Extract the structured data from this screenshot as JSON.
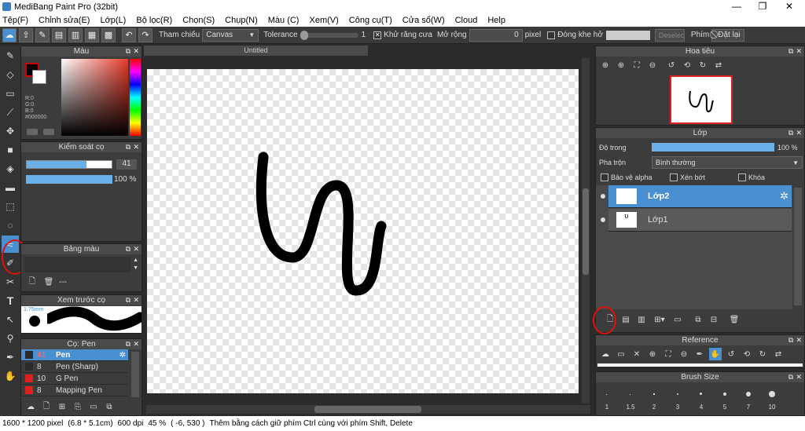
{
  "window": {
    "title": "MediBang Paint Pro (32bit)",
    "minimize": "—",
    "maximize": "❐",
    "close": "✕"
  },
  "menu": [
    "Tệp(F)",
    "Chỉnh sửa(E)",
    "Lớp(L)",
    "Bộ lọc(R)",
    "Chọn(S)",
    "Chụp(N)",
    "Màu (C)",
    "Xem(V)",
    "Công cụ(T)",
    "Cửa sổ(W)",
    "Cloud",
    "Help"
  ],
  "toolbar": {
    "reference_label": "Tham chiếu",
    "reference_value": "Canvas",
    "tolerance_label": "Tolerance",
    "tolerance_value": "1",
    "antialias_label": "Khử răng cưa",
    "expand_label": "Mở rộng",
    "expand_value": "0",
    "expand_unit": "pixel",
    "close_gap_label": "Đóng khe hở",
    "deselect_label": "Deselec",
    "key_label": "Phím",
    "reset_label": "Đặt lại"
  },
  "color_panel": {
    "title": "Màu",
    "r": "R:0",
    "g": "G:0",
    "b": "B:0",
    "hex": "#000000"
  },
  "brush_control": {
    "title": "Kiểm soát cọ",
    "size_value": "41",
    "opacity_value": "100 %",
    "size_fraction": 0.7,
    "opacity_fraction": 1.0
  },
  "palette": {
    "title": "Bảng màu",
    "dash": "---"
  },
  "preview": {
    "title": "Xem trước cọ",
    "size_label": "1.75mm"
  },
  "brush_list": {
    "title": "Cọ: Pen",
    "items": [
      {
        "size": "41",
        "name": "Pen",
        "color": "#2a2a2a",
        "selected": true
      },
      {
        "size": "8",
        "name": "Pen (Sharp)",
        "color": "#2a2a2a",
        "selected": false
      },
      {
        "size": "10",
        "name": "G Pen",
        "color": "#e02020",
        "selected": false
      },
      {
        "size": "8",
        "name": "Mapping Pen",
        "color": "#e02020",
        "selected": false
      }
    ]
  },
  "canvas": {
    "tab": "Untitled"
  },
  "navigator": {
    "title": "Hoa tiêu"
  },
  "layers": {
    "title": "Lớp",
    "opacity_label": "Độ trong",
    "opacity_value": "100 %",
    "opacity_fraction": 1.0,
    "blend_label": "Pha trộn",
    "blend_value": "Bình thường",
    "protect_alpha": "Bảo vệ alpha",
    "clipping": "Xén bớt",
    "lock": "Khóa",
    "items": [
      {
        "name": "Lớp2",
        "selected": true
      },
      {
        "name": "Lớp1",
        "selected": false
      }
    ]
  },
  "reference": {
    "title": "Reference"
  },
  "brush_size": {
    "title": "Brush Size",
    "sizes": [
      "1",
      "1.5",
      "2",
      "3",
      "4",
      "5",
      "7",
      "10"
    ]
  },
  "status": {
    "dims": "1600 * 1200 pixel",
    "cm": "(6.8 * 5.1cm)",
    "dpi": "600 dpi",
    "zoom": "45 %",
    "coord": "( -6, 530 )",
    "hint": "Thêm bằng cách giữ phím Ctrl cùng với phím Shift, Delete"
  }
}
